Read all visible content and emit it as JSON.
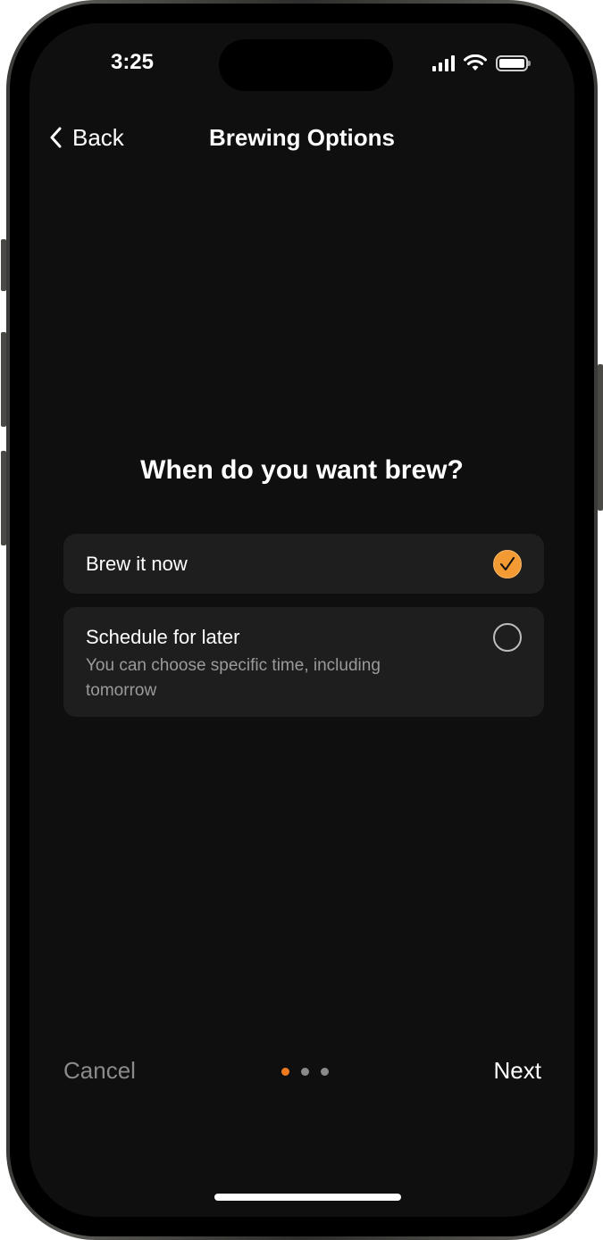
{
  "status_bar": {
    "time": "3:25"
  },
  "nav": {
    "back_label": "Back",
    "title": "Brewing Options"
  },
  "question": "When do you want brew?",
  "options": [
    {
      "title": "Brew it now",
      "subtitle": "",
      "selected": true
    },
    {
      "title": "Schedule for later",
      "subtitle": "You can choose specific time, including tomorrow",
      "selected": false
    }
  ],
  "footer": {
    "cancel_label": "Cancel",
    "next_label": "Next",
    "page_index": 1,
    "page_count": 3
  },
  "colors": {
    "accent": "#f39a33",
    "active_dot": "#f07a22",
    "background": "#0f0f0f",
    "card": "#1e1e1e"
  },
  "icons": [
    "chevron-left-icon",
    "check-icon",
    "signal-icon",
    "wifi-icon",
    "battery-icon"
  ]
}
